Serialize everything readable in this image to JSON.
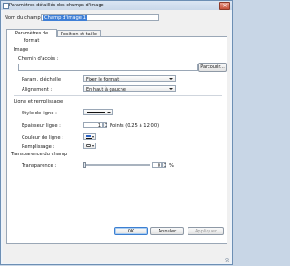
{
  "window": {
    "title": "Paramètres détaillés des champs d'image",
    "close_glyph": "✕"
  },
  "field_name": {
    "label": "Nom du champ :",
    "value": "Champ d'image 1"
  },
  "tabs": [
    {
      "label": "Paramètres de format",
      "active": true
    },
    {
      "label": "Position et taille",
      "active": false
    }
  ],
  "image_section": {
    "title": "Image",
    "path_label": "Chemin d'accès :",
    "path_value": "",
    "browse_label": "Parcourir..."
  },
  "scale": {
    "label": "Param. d'échelle :",
    "value": "Fixer le format"
  },
  "alignment": {
    "label": "Alignement :",
    "value": "En haut à gauche"
  },
  "line_section": {
    "title": "Ligne et remplissage",
    "style_label": "Style de ligne :",
    "thickness_label": "Épaisseur ligne :",
    "thickness_value": "1",
    "thickness_hint": "Points (0.25 à 12.00)",
    "line_color_label": "Couleur de ligne :",
    "fill_label": "Remplissage :"
  },
  "transparency_section": {
    "title": "Transparence du champ",
    "label": "Transparence :",
    "value": "0",
    "unit": "%",
    "level_percent": 0
  },
  "footer": {
    "ok_label": "OK",
    "cancel_label": "Annuler",
    "apply_label": "Appliquer"
  },
  "colors": {
    "accent": "#3c7fd1",
    "selection": "#3f7fd6",
    "window_border": "#6d8fb4"
  }
}
